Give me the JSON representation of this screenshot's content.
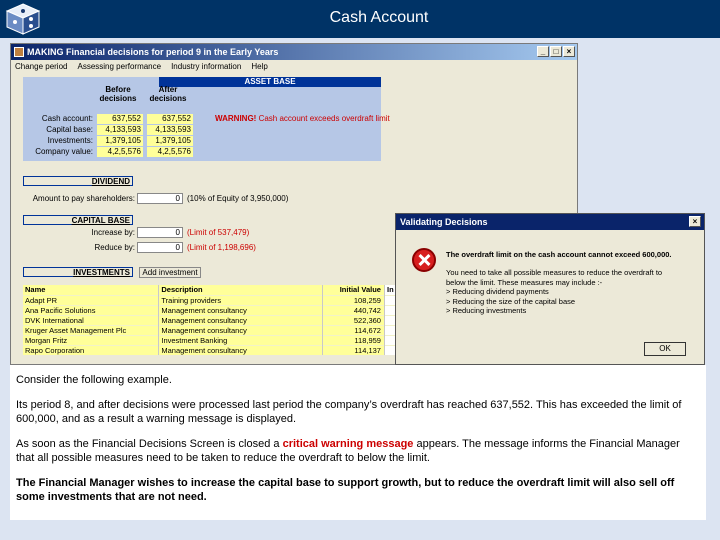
{
  "slide": {
    "title": "Cash Account"
  },
  "app": {
    "title": "MAKING Financial decisions for period 9 in the Early Years",
    "menu": [
      "Change period",
      "Assessing performance",
      "Industry information",
      "Help"
    ],
    "asset_base": {
      "header": "ASSET BASE",
      "col_before": "Before\ndecisions",
      "col_after": "After\ndecisions",
      "rows": [
        {
          "label": "Cash account:",
          "before": "637,552",
          "after": "637,552"
        },
        {
          "label": "Capital base:",
          "before": "4,133,593",
          "after": "4,133,593"
        },
        {
          "label": "Investments:",
          "before": "1,379,105",
          "after": "1,379,105"
        },
        {
          "label": "Company value:",
          "before": "4,2,5,576",
          "after": "4,2,5,576"
        }
      ],
      "warning_label": "WARNING!",
      "warning_rest": "Cash account exceeds overdraft limit"
    },
    "dividend": {
      "title": "DIVIDEND",
      "label": "Amount to pay shareholders:",
      "value": "0",
      "note": "(10% of Equity of 3,950,000)"
    },
    "capital_base": {
      "title": "CAPITAL BASE",
      "increase_label": "Increase by:",
      "increase_value": "0",
      "increase_note": "(Limit of 537,479)",
      "reduce_label": "Reduce by:",
      "reduce_value": "0",
      "reduce_note": "(Limit of 1,198,696)"
    },
    "investments": {
      "title": "INVESTMENTS",
      "add_button": "Add investment",
      "headers": [
        "Name",
        "Description",
        "Initial Value",
        "In"
      ],
      "rows": [
        [
          "Adapt PR",
          "Training providers",
          "108,259"
        ],
        [
          "Ana Pacific Solutions",
          "Management consultancy",
          "440,742"
        ],
        [
          "DVK International",
          "Management consultancy",
          "522,360"
        ],
        [
          "Kruger Asset Management Plc",
          "Management consultancy",
          "114,672"
        ],
        [
          "Morgan Fritz",
          "Investment Banking",
          "118,959"
        ],
        [
          "Rapo Corporation",
          "Management consultancy",
          "114,137"
        ]
      ]
    }
  },
  "dialog": {
    "title": "Validating Decisions",
    "message": "The overdraft limit on the cash account cannot exceed 600,000.",
    "lines": [
      "You need to take all possible measures to reduce the overdraft to",
      "below the limit. These measures may include :-",
      "> Reducing dividend payments",
      "> Reducing the size of the capital base",
      "> Reducing investments"
    ],
    "ok_label": "OK"
  },
  "text": {
    "p1": "Consider the following example.",
    "p2": "Its period 8, and after decisions were processed last period the company’s overdraft has reached 637,552. This has exceeded the limit of 600,000, and as a result a warning message is displayed.",
    "p3_before": "As soon as the Financial Decisions Screen is closed a ",
    "p3_highlight": "critical warning message",
    "p3_after": " appears. The message informs the Financial Manager that all possible measures need to be taken to reduce the overdraft to below the limit.",
    "p4": "The Financial Manager wishes to increase the capital base to support growth, but to reduce the overdraft limit will also sell off some investments that are not need."
  }
}
